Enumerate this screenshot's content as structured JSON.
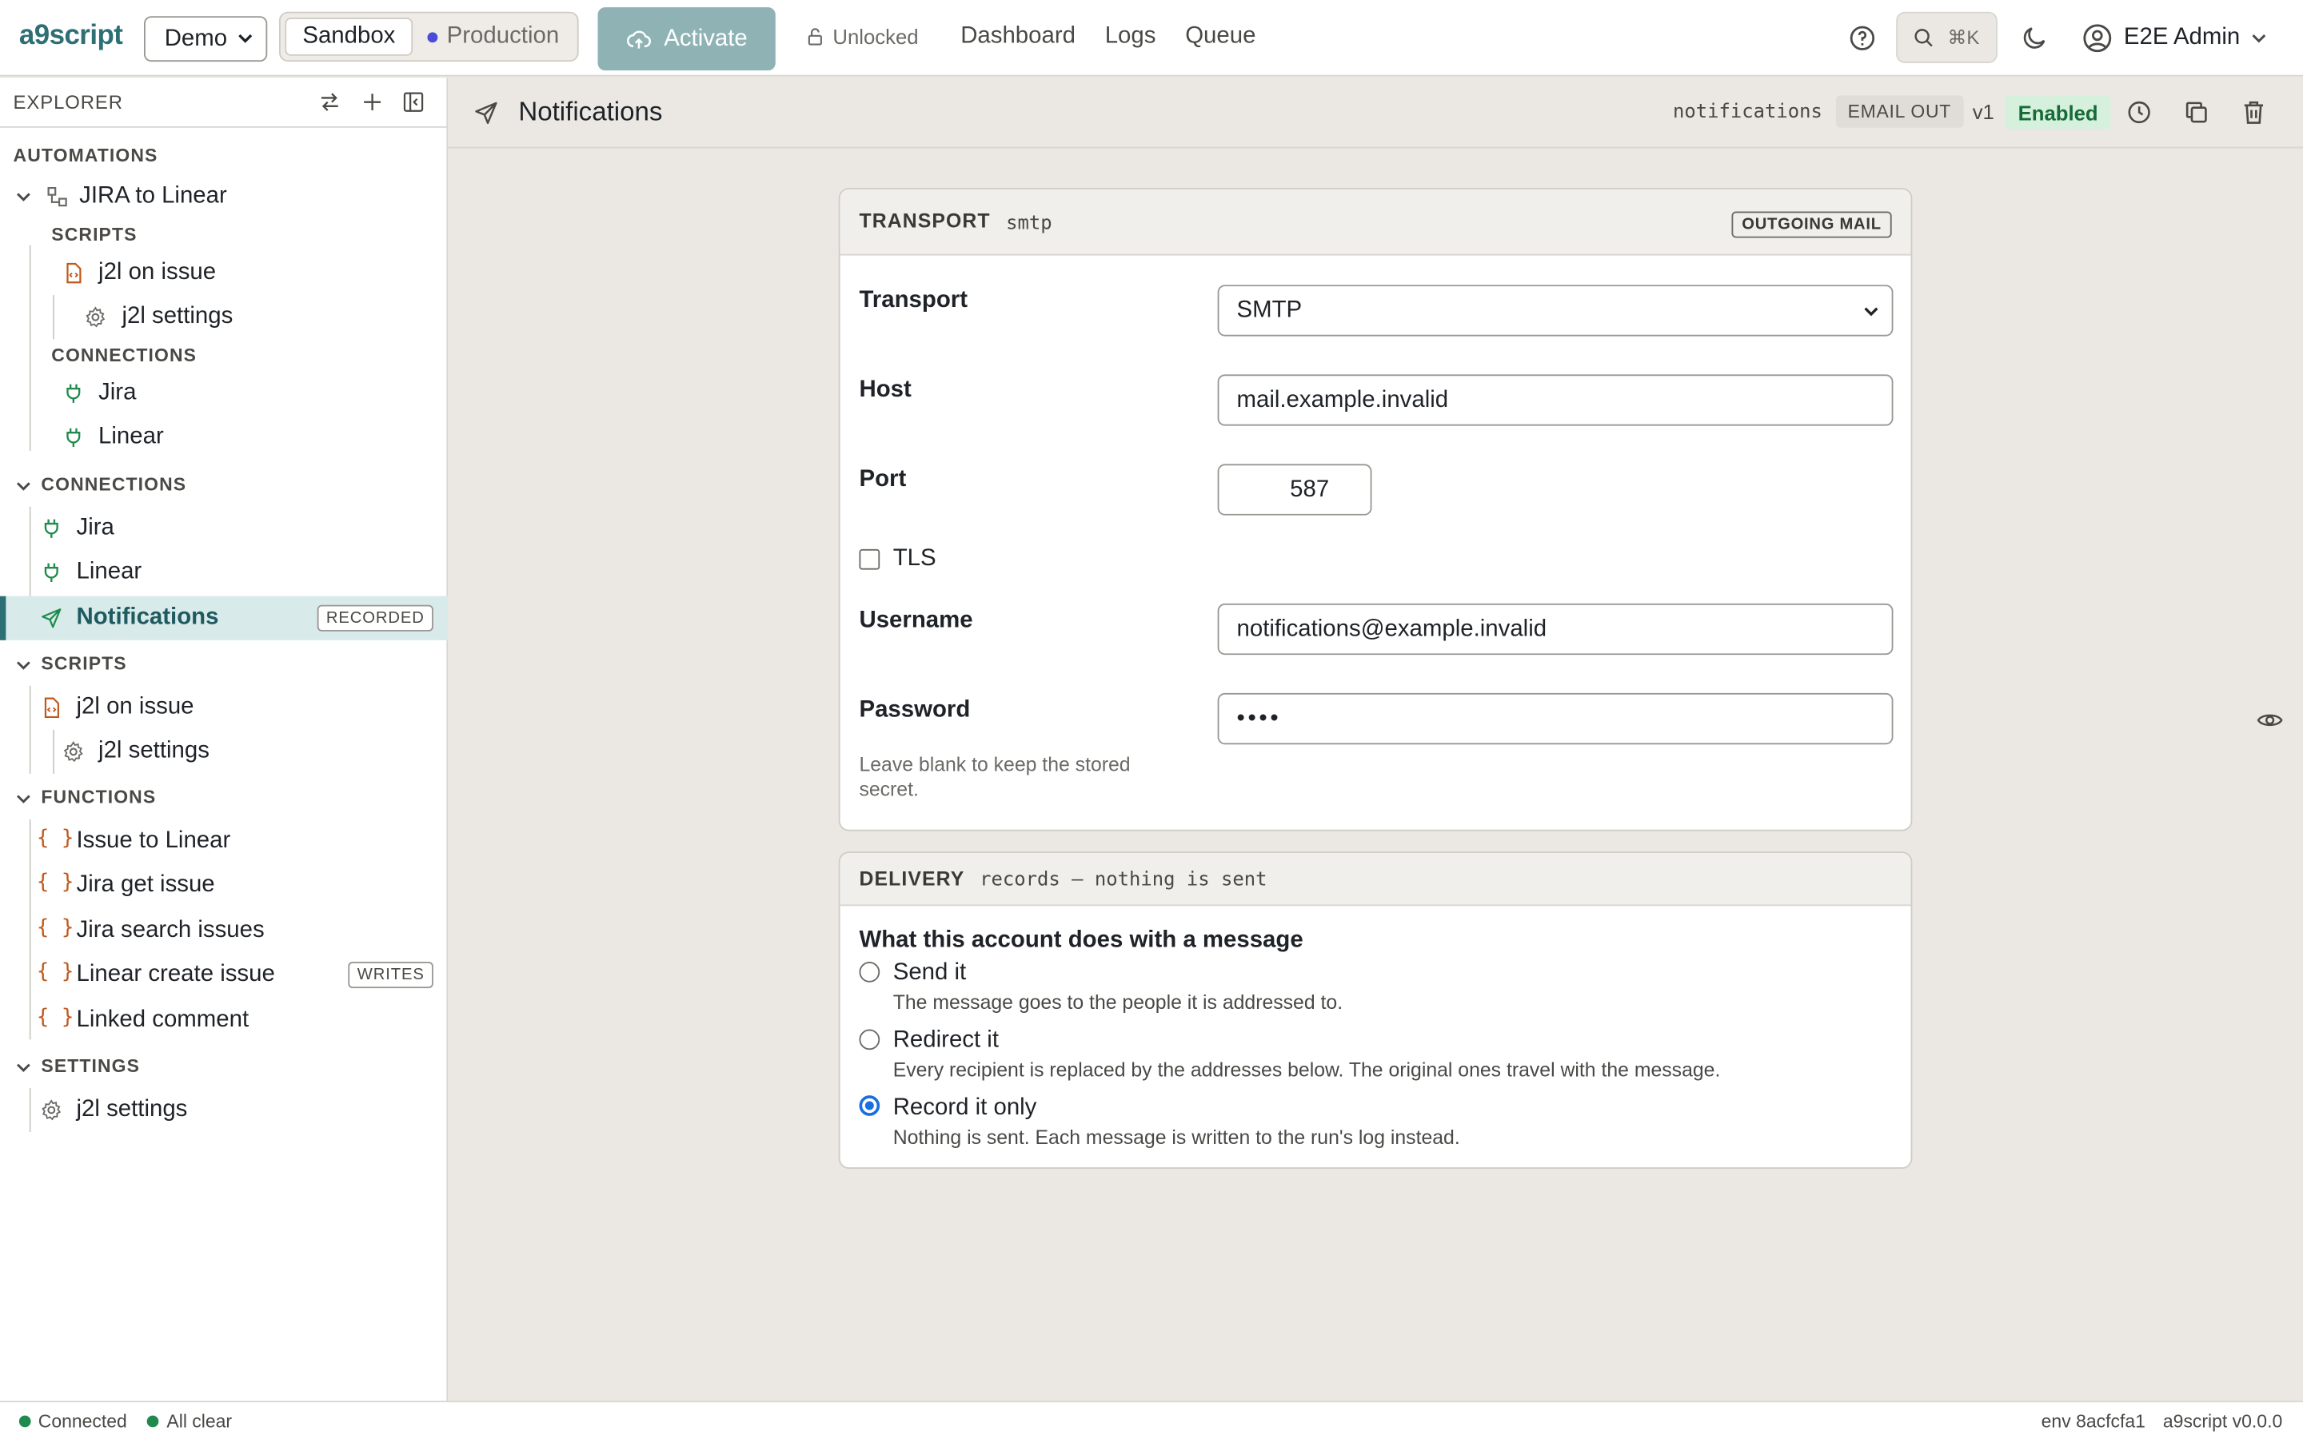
{
  "topbar": {
    "brand": "a9script",
    "workspace_select": "Demo",
    "env_sandbox": "Sandbox",
    "env_production": "Production",
    "activate": "Activate",
    "lock_status": "Unlocked",
    "nav": [
      "Dashboard",
      "Logs",
      "Queue"
    ],
    "search_shortcut": "⌘K",
    "user": "E2E Admin"
  },
  "sidebar": {
    "header": "EXPLORER",
    "automations_section": "AUTOMATIONS",
    "automation": "JIRA to Linear",
    "auto_scripts_section": "SCRIPTS",
    "auto_script_1": "j2l on issue",
    "auto_script_2": "j2l settings",
    "auto_connections_section": "CONNECTIONS",
    "auto_conn_1": "Jira",
    "auto_conn_2": "Linear",
    "connections_section": "CONNECTIONS",
    "conn_1": "Jira",
    "conn_2": "Linear",
    "conn_3": "Notifications",
    "conn_3_tag": "RECORDED",
    "scripts_section": "SCRIPTS",
    "script_1": "j2l on issue",
    "script_2": "j2l settings",
    "functions_section": "FUNCTIONS",
    "func_1": "Issue to Linear",
    "func_2": "Jira get issue",
    "func_3": "Jira search issues",
    "func_4": "Linear create issue",
    "func_4_tag": "WRITES",
    "func_5": "Linked comment",
    "settings_section": "SETTINGS",
    "settings_1": "j2l settings"
  },
  "editor": {
    "title": "Notifications",
    "slug": "notifications",
    "kind_badge": "EMAIL OUT",
    "version": "v1",
    "status": "Enabled"
  },
  "transport": {
    "header": "TRANSPORT",
    "header_sub": "smtp",
    "chip": "OUTGOING MAIL",
    "transport_label": "Transport",
    "transport_value": "SMTP",
    "host_label": "Host",
    "host_value": "mail.example.invalid",
    "port_label": "Port",
    "port_value": "587",
    "tls_label": "TLS",
    "tls_checked": false,
    "username_label": "Username",
    "username_value": "notifications@example.invalid",
    "password_label": "Password",
    "password_value": "••••",
    "password_hint": "Leave blank to keep the stored secret."
  },
  "delivery": {
    "header": "DELIVERY",
    "header_sub": "records — nothing is sent",
    "question": "What this account does with a message",
    "options": [
      {
        "label": "Send it",
        "desc": "The message goes to the people it is addressed to.",
        "selected": false
      },
      {
        "label": "Redirect it",
        "desc": "Every recipient is replaced by the addresses below. The original ones travel with the message.",
        "selected": false
      },
      {
        "label": "Record it only",
        "desc": "Nothing is sent. Each message is written to the run's log instead.",
        "selected": true
      }
    ]
  },
  "statusbar": {
    "connected": "Connected",
    "all_clear": "All clear",
    "env": "env 8acfcfa1",
    "version": "a9script v0.0.0"
  },
  "colors": {
    "brand": "#2e6f75",
    "activate": "#8fb3b5",
    "enabled_bg": "#d5f0dc",
    "enabled_fg": "#176b38",
    "connection_icon": "#1f8a4c",
    "script_icon": "#c0581b",
    "radio_selected": "#1a6fe0"
  },
  "icons": {
    "activate": "cloud-upload-icon",
    "lock": "lock-open-icon",
    "help": "help-circle-icon",
    "search": "search-icon",
    "theme": "moon-icon",
    "user": "user-circle-icon",
    "connection": "plug-icon",
    "script": "file-code-icon",
    "settings": "gear-icon",
    "function": "braces-icon",
    "notification": "send-icon"
  }
}
